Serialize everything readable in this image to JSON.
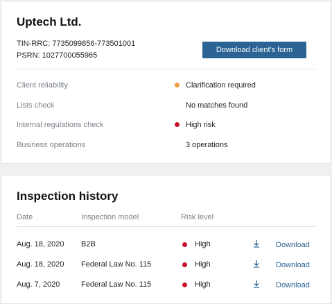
{
  "company": {
    "name": "Uptech Ltd.",
    "tin_line": "TIN-RRC: 7735099856-773501001",
    "psrn_line": "PSRN: 1027700055965",
    "download_button": "Download client's form"
  },
  "checks": [
    {
      "label": "Client reliability",
      "value": "Clarification required",
      "indicator": "orange"
    },
    {
      "label": "Lists check",
      "value": "No matches found",
      "indicator": "none"
    },
    {
      "label": "Internal regulations check",
      "value": "High risk",
      "indicator": "red"
    },
    {
      "label": "Business operations",
      "value": "3 operations",
      "indicator": "none"
    }
  ],
  "history": {
    "title": "Inspection history",
    "columns": {
      "date": "Date",
      "model": "Inspection model",
      "risk": "Risk level"
    },
    "rows": [
      {
        "date": "Aug. 18, 2020",
        "model": "B2B",
        "risk": "High",
        "action": "Download"
      },
      {
        "date": "Aug. 18, 2020",
        "model": "Federal Law No. 115",
        "risk": "High",
        "action": "Download"
      },
      {
        "date": "Aug. 7, 2020",
        "model": "Federal Law No. 115",
        "risk": "High",
        "action": "Download"
      }
    ]
  },
  "colors": {
    "accent": "#2b6494",
    "orange": "#f0a03c",
    "red": "#c8102e",
    "muted_text": "#7a828a"
  },
  "icons": {
    "download": "download-icon",
    "status": "status-dot"
  }
}
